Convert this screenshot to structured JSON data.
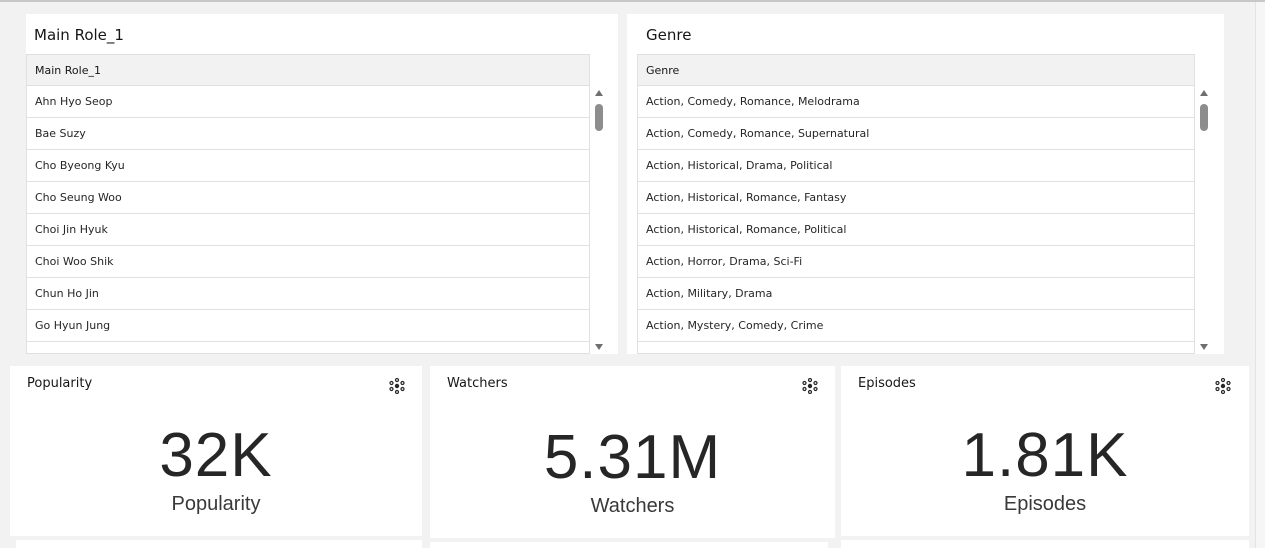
{
  "main_role_panel": {
    "title": "Main Role_1",
    "column_header": "Main Role_1",
    "rows": [
      "Ahn Hyo Seop",
      "Bae Suzy",
      "Cho Byeong Kyu",
      "Cho Seung Woo",
      "Choi Jin Hyuk",
      "Choi Woo Shik",
      "Chun Ho Jin",
      "Go Hyun Jung"
    ]
  },
  "genre_panel": {
    "title": "Genre",
    "column_header": "Genre",
    "rows": [
      "Action, Comedy, Romance, Melodrama",
      "Action, Comedy, Romance, Supernatural",
      "Action, Historical, Drama, Political",
      "Action, Historical, Romance, Fantasy",
      "Action, Historical, Romance, Political",
      "Action, Horror, Drama, Sci-Fi",
      "Action, Military, Drama",
      "Action, Mystery, Comedy, Crime"
    ]
  },
  "kpis": [
    {
      "title": "Popularity",
      "value": "32K",
      "label": "Popularity",
      "icon": "insights-icon"
    },
    {
      "title": "Watchers",
      "value": "5.31M",
      "label": "Watchers",
      "icon": "insights-icon"
    },
    {
      "title": "Episodes",
      "value": "1.81K",
      "label": "Episodes",
      "icon": "insights-icon"
    }
  ],
  "colors": {
    "background": "#f2f2f2",
    "panel": "#ffffff",
    "header": "#f2f2f2",
    "border": "#e0e0e0",
    "text": "#161616"
  }
}
